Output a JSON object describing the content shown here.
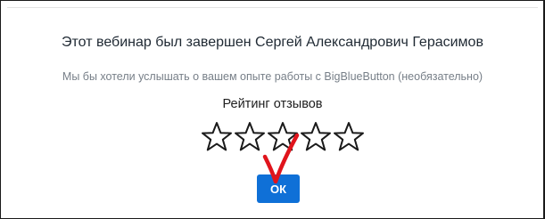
{
  "dialog": {
    "title": "Этот вебинар был завершен Сергей Александрович Герасимов",
    "subtitle": "Мы бы хотели услышать о вашем опыте работы с BigBlueButton (необязательно)",
    "rating_label": "Рейтинг отзывов",
    "ok_label": "ОК"
  },
  "rating": {
    "max_stars": 5,
    "selected": 0
  },
  "colors": {
    "ok_button": "#0f70d7",
    "annotation_check": "#e0141c",
    "star_stroke": "#1a1a1a"
  }
}
